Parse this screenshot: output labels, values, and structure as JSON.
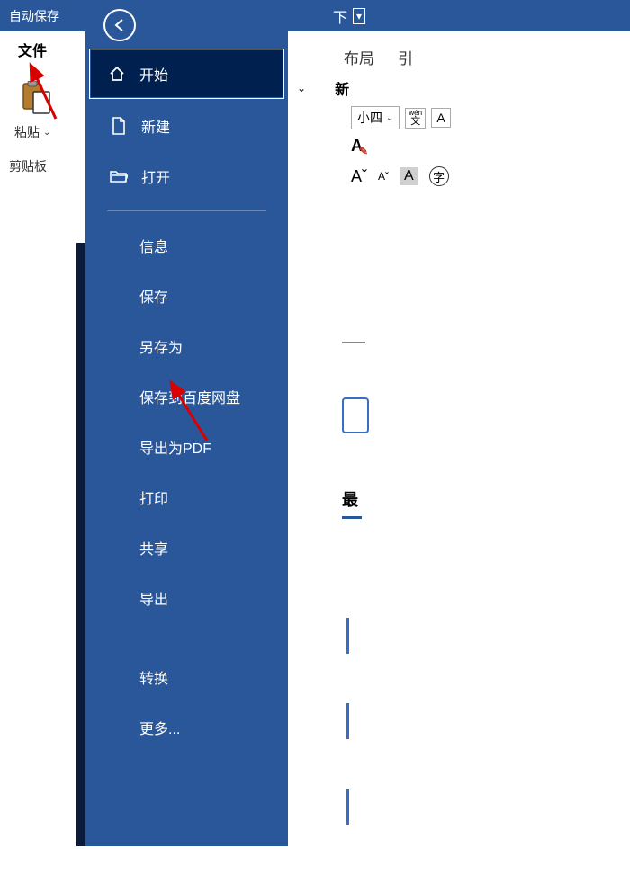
{
  "titlebar": {
    "autosave": "自动保存"
  },
  "maintabs": {
    "file": "文件"
  },
  "clipboard": {
    "paste": "粘贴",
    "section": "剪贴板"
  },
  "filemenu": {
    "start": "开始",
    "new": "新建",
    "open": "打开",
    "info": "信息",
    "save": "保存",
    "saveas": "另存为",
    "savetobaidu": "保存到百度网盘",
    "exportpdf": "导出为PDF",
    "print": "打印",
    "share": "共享",
    "export": "导出",
    "transform": "转换",
    "more": "更多..."
  },
  "ribbon": {
    "layout": "布局",
    "ref": "引",
    "new": "新",
    "fontsize": "小四",
    "wentop": "wén",
    "wenbot": "文",
    "down": "下",
    "zi": "字"
  },
  "right": {
    "recent": "最"
  }
}
